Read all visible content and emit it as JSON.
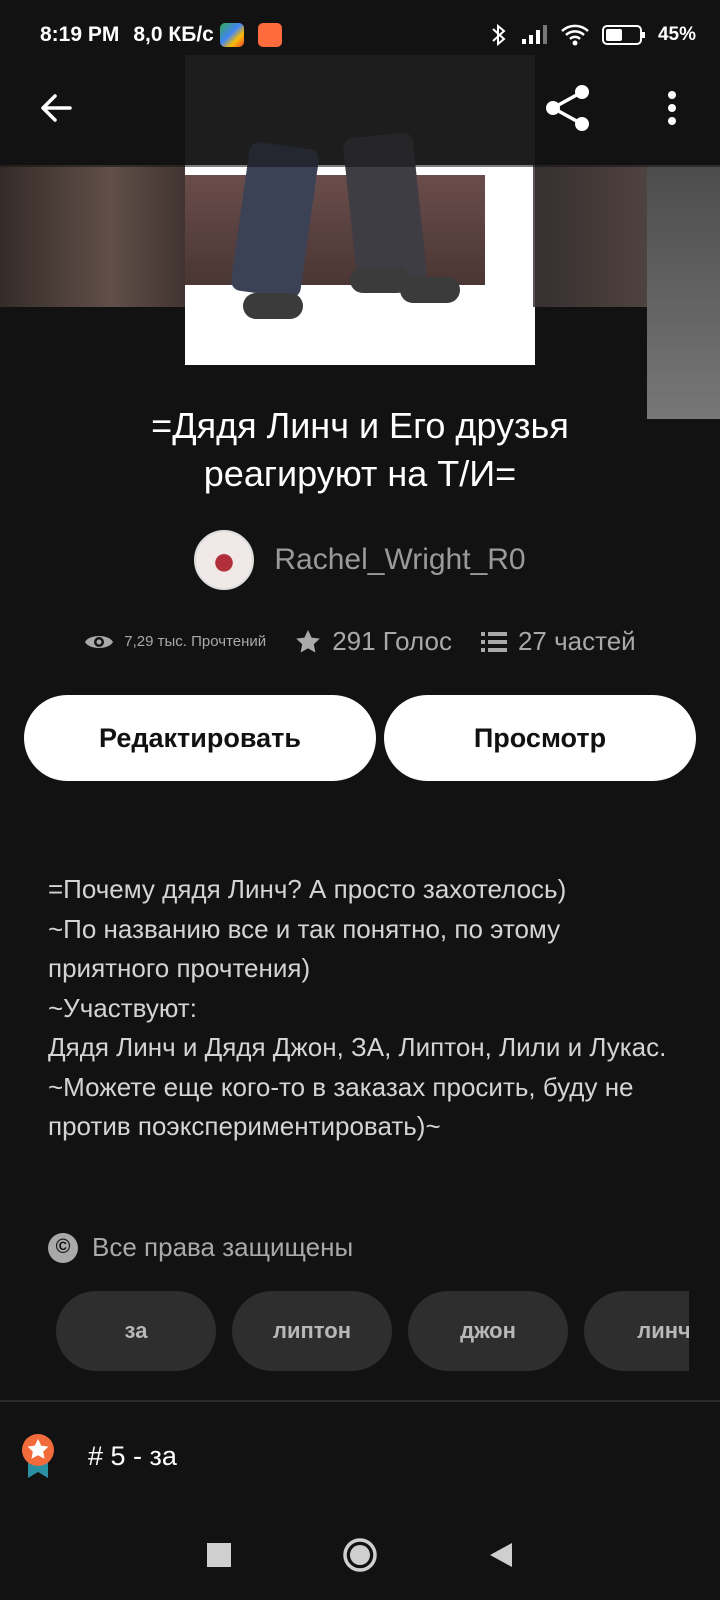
{
  "status": {
    "time": "8:19 PM",
    "speed": "8,0 КБ/с",
    "battery": "45%",
    "icons": [
      "play-store-icon",
      "game-icon",
      "bluetooth-icon",
      "signal-icon",
      "wifi-icon",
      "battery-icon"
    ]
  },
  "story": {
    "title": "=Дядя Линч и Его друзья реагируют на Т/И=",
    "author": "Rachel_Wright_R0",
    "reads": "7,29 тыс. Прочтений",
    "votes": "291 Голос",
    "parts": "27 частей"
  },
  "buttons": {
    "edit": "Редактировать",
    "view": "Просмотр"
  },
  "description": "=Почему дядя Линч? А просто захотелось)\n~По названию все и так понятно, по этому приятного прочтения)\n~Участвуют:\nДядя Линч и Дядя Джон, ЗА, Липтон, Лили и Лукас.\n~Можете еще кого-то в заказах просить, буду не против поэкспериментировать)~",
  "rights": "Все права защищены",
  "tags": [
    "за",
    "липтон",
    "джон",
    "линч"
  ],
  "rank": "# 5 - за",
  "colors": {
    "background": "#121212",
    "tag_bg": "#2e2e2e",
    "rank_badge": "#f26b3a"
  }
}
